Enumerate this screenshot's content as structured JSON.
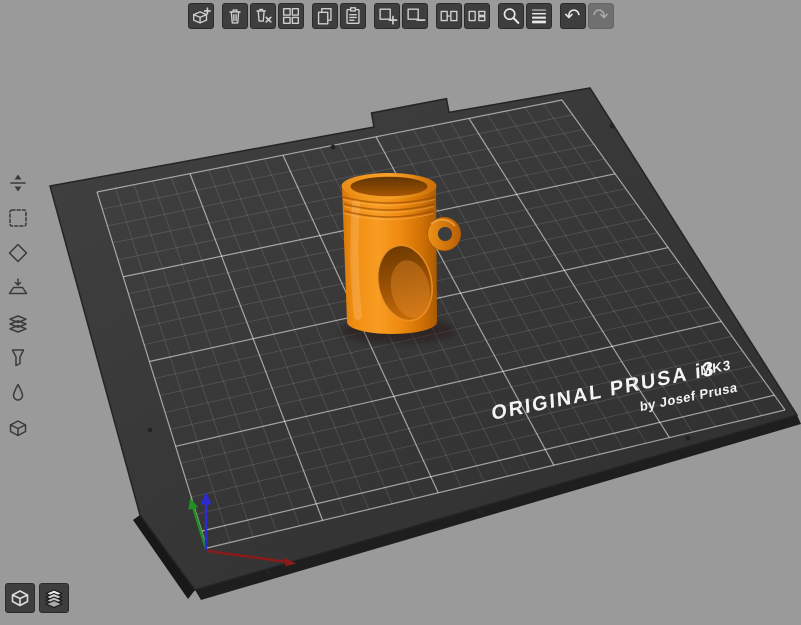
{
  "viewport": {
    "label": "3D build plate view"
  },
  "top_toolbar": {
    "groups": [
      {
        "items": [
          {
            "id": "add",
            "label": "Add object"
          }
        ]
      },
      {
        "items": [
          {
            "id": "delete",
            "label": "Delete"
          },
          {
            "id": "delete-all",
            "label": "Delete all"
          },
          {
            "id": "arrange",
            "label": "Arrange"
          }
        ]
      },
      {
        "items": [
          {
            "id": "copy",
            "label": "Copy"
          },
          {
            "id": "paste",
            "label": "Paste"
          }
        ]
      },
      {
        "items": [
          {
            "id": "add-instance",
            "label": "Add instance"
          },
          {
            "id": "remove-instance",
            "label": "Remove instance"
          }
        ]
      },
      {
        "items": [
          {
            "id": "split-objects",
            "label": "Split to objects"
          },
          {
            "id": "split-parts",
            "label": "Split to parts"
          }
        ]
      },
      {
        "items": [
          {
            "id": "search",
            "label": "Search"
          },
          {
            "id": "layer-height",
            "label": "Variable layer height"
          }
        ]
      },
      {
        "items": [
          {
            "id": "undo",
            "label": "Undo"
          },
          {
            "id": "redo",
            "label": "Redo",
            "disabled": true
          }
        ]
      }
    ]
  },
  "left_toolbar": {
    "items": [
      {
        "id": "move",
        "label": "Move"
      },
      {
        "id": "select",
        "label": "Select"
      },
      {
        "id": "rotate",
        "label": "Rotate"
      },
      {
        "id": "place-on-face",
        "label": "Place on face"
      },
      {
        "id": "cut",
        "label": "Cut"
      },
      {
        "id": "supports",
        "label": "Supports"
      },
      {
        "id": "seam",
        "label": "Seam"
      },
      {
        "id": "view-cube",
        "label": "View"
      }
    ]
  },
  "view_toggle": {
    "items": [
      {
        "id": "editor-3d",
        "label": "3D editor view"
      },
      {
        "id": "preview",
        "label": "Preview"
      }
    ]
  },
  "bed": {
    "brand": "ORIGINAL PRUSA i3",
    "brand_model": "MK3",
    "brand_byline": "by Josef Prusa"
  },
  "model": {
    "name": "Orange cylindrical part",
    "color": "#f08d12"
  },
  "colors": {
    "background": "#9a9a9a",
    "bed": "#373737",
    "grid_line": "#ffffff",
    "model_orange": "#f08d12",
    "axis_x": "#8b1a1a",
    "axis_y": "#1f8f1f",
    "axis_z": "#2b2bd0"
  }
}
